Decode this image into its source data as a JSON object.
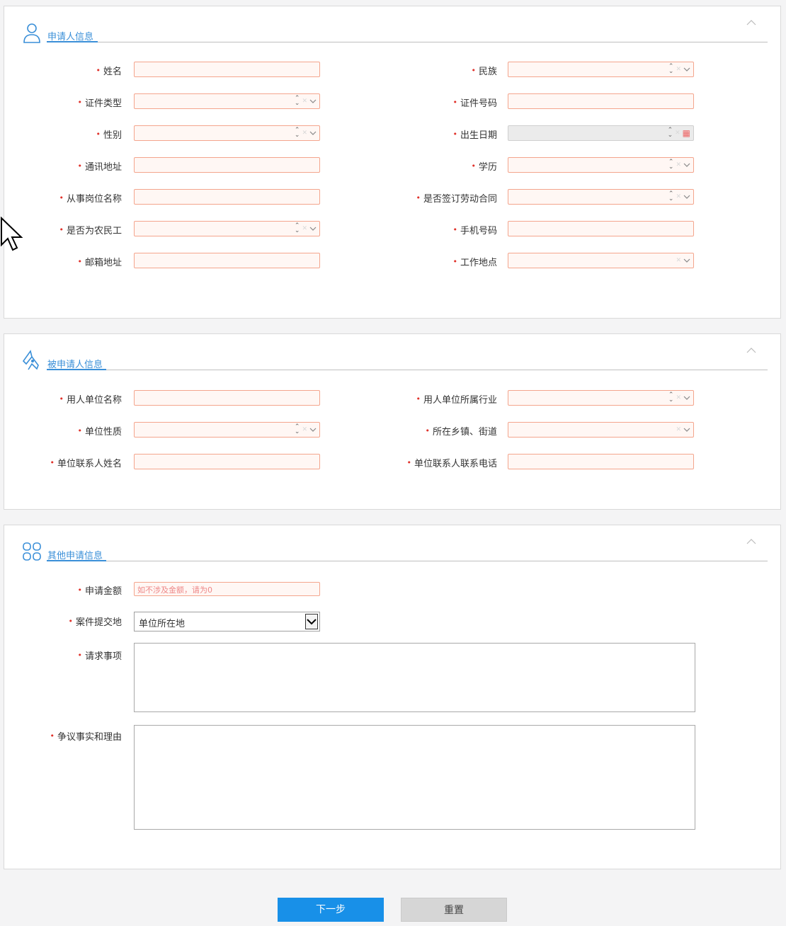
{
  "section1": {
    "title": "申请人信息",
    "left_fields": [
      {
        "label": "姓名",
        "type": "text"
      },
      {
        "label": "证件类型",
        "type": "select"
      },
      {
        "label": "性别",
        "type": "select"
      },
      {
        "label": "通讯地址",
        "type": "text"
      },
      {
        "label": "从事岗位名称",
        "type": "text"
      },
      {
        "label": "是否为农民工",
        "type": "select"
      },
      {
        "label": "邮箱地址",
        "type": "text"
      }
    ],
    "right_fields": [
      {
        "label": "民族",
        "type": "select"
      },
      {
        "label": "证件号码",
        "type": "text"
      },
      {
        "label": "出生日期",
        "type": "date"
      },
      {
        "label": "学历",
        "type": "select"
      },
      {
        "label": "是否签订劳动合同",
        "type": "select"
      },
      {
        "label": "手机号码",
        "type": "text"
      },
      {
        "label": "工作地点",
        "type": "dropdown"
      }
    ]
  },
  "section2": {
    "title": "被申请人信息",
    "left_fields": [
      {
        "label": "用人单位名称",
        "type": "text"
      },
      {
        "label": "单位性质",
        "type": "select"
      },
      {
        "label": "单位联系人姓名",
        "type": "text"
      }
    ],
    "right_fields": [
      {
        "label": "用人单位所属行业",
        "type": "select"
      },
      {
        "label": "所在乡镇、街道",
        "type": "dropdown"
      },
      {
        "label": "单位联系人联系电话",
        "type": "text"
      }
    ]
  },
  "section3": {
    "title": "其他申请信息",
    "amount_label": "申请金额",
    "amount_placeholder": "如不涉及金额，请为0",
    "jurisdiction_label": "案件提交地",
    "jurisdiction_value": "单位所在地",
    "request_label": "请求事项",
    "facts_label": "争议事实和理由"
  },
  "buttons": {
    "next": "下一步",
    "reset": "重置"
  },
  "colors": {
    "accent": "#3a8fd8",
    "required": "#e0322b",
    "primary_button": "#1890e8",
    "field_border": "#f4a58d"
  }
}
